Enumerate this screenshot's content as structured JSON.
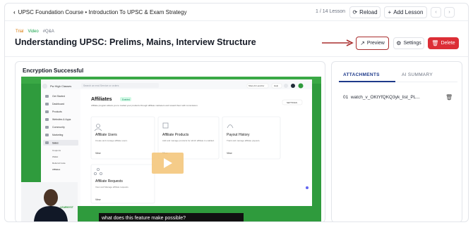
{
  "topbar": {
    "breadcrumb": "UPSC Foundation Course • Introduction To UPSC & Exam Strategy",
    "lesson_count": "1 / 14 Lesson",
    "reload_label": "Reload",
    "add_lesson_label": "Add Lesson"
  },
  "lesson": {
    "tags": [
      "Trial",
      "Video",
      "#Q&A"
    ],
    "title": "Understanding UPSC: Prelims, Mains, Interview Structure",
    "preview_label": "Preview",
    "settings_label": "Settings",
    "delete_label": "Delete"
  },
  "player": {
    "status": "Encryption Successful",
    "caption": "what does this feature make possible?",
    "app": {
      "brand": "Pw High Classes",
      "search_placeholder": "Search an end Service or orders",
      "header_buttons": [
        "Share Atr Launcher",
        "Help"
      ],
      "nav": [
        "Get Started",
        "Dashboard",
        "Products",
        "Websites & Apps",
        "Community",
        "Marketing",
        "Sales"
      ],
      "subnav": [
        "Coupons",
        "Wallet",
        "Referral Code",
        "Affiliates"
      ],
      "nav_more": "Users",
      "page_title": "Affiliates",
      "page_badge": "Enabled",
      "page_desc": "Affiliate program allows you to market your products through affiliate marketers and reward them with commission.",
      "settings_btn": "SETTINGS",
      "cards": [
        {
          "title": "Affiliate Users",
          "desc": "Create and manage affiliate users.",
          "link": "View"
        },
        {
          "title": "Affiliate Products",
          "desc": "Add and manage products for which affiliate is enabled.",
          "link": "View"
        },
        {
          "title": "Payout History",
          "desc": "Track and manage affiliate payouts.",
          "link": "View"
        },
        {
          "title": "Affiliate Requests",
          "desc": "View and Manage affiliate requests.",
          "link": "View"
        }
      ],
      "watermark": "LEARNYST"
    }
  },
  "panel": {
    "tabs": [
      "ATTACHMENTS",
      "AI SUMMARY"
    ],
    "attachments": [
      {
        "index": "01",
        "name": "watch_v_OKtYfQKQ3yk_list_PL..."
      }
    ]
  }
}
